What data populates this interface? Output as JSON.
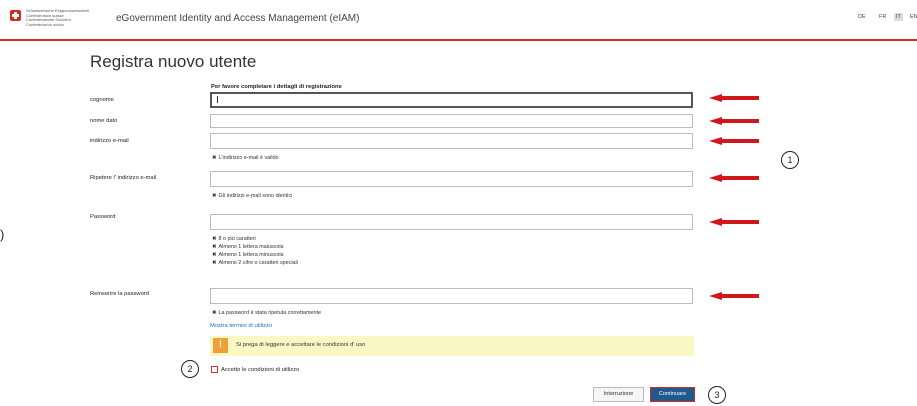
{
  "header": {
    "confederation_lines": [
      "Schweizerische Eidgenossenschaft",
      "Confédération suisse",
      "Confederazione Svizzera",
      "Confederaziun svizra"
    ],
    "app_title": "eGovernment Identity and Access Management (eIAM)",
    "languages": [
      "DE",
      "FR",
      "IT",
      "EN"
    ],
    "active_language": "IT",
    "accent_color": "#d52b1e"
  },
  "page": {
    "title": "Registra nuovo utente",
    "instruction": "Per favore completare i dettagli di registrazione"
  },
  "form": {
    "fields": [
      {
        "label": "cognome",
        "value": ""
      },
      {
        "label": "nome dato",
        "value": ""
      },
      {
        "label": "indirizzo e-mail",
        "value": ""
      },
      {
        "label": "Ripetere l' indirizzo e-mail",
        "value": ""
      },
      {
        "label": "Password",
        "value": ""
      },
      {
        "label": "Reinserire la password",
        "value": ""
      }
    ],
    "hints": {
      "email_valid": "L'indirizzo e-mail è valido",
      "emails_identical": "Gli indirizzi e-mail sono identici",
      "password_rules": [
        "8 o più caratteri",
        "Almeno 1 lettera maiuscola",
        "Almeno 1 lettera minuscola",
        "Almeno 2 cifre o caratteri speciali"
      ],
      "password_repeated": "La password è stata ripetuta correttamente"
    },
    "terms_link": "Mostra termini di utilizzo",
    "warning": "Si prega di leggere e accettare le condizioni d' uso",
    "accept_label": "Accetto le condizioni di utilizzo",
    "accept_checked": false
  },
  "buttons": {
    "cancel": "Interruzione",
    "continue": "Continuare"
  },
  "annotations": {
    "markers": [
      "1",
      "2",
      "3"
    ],
    "edge_glyph": ")",
    "arrow_color": "#d0171b"
  }
}
